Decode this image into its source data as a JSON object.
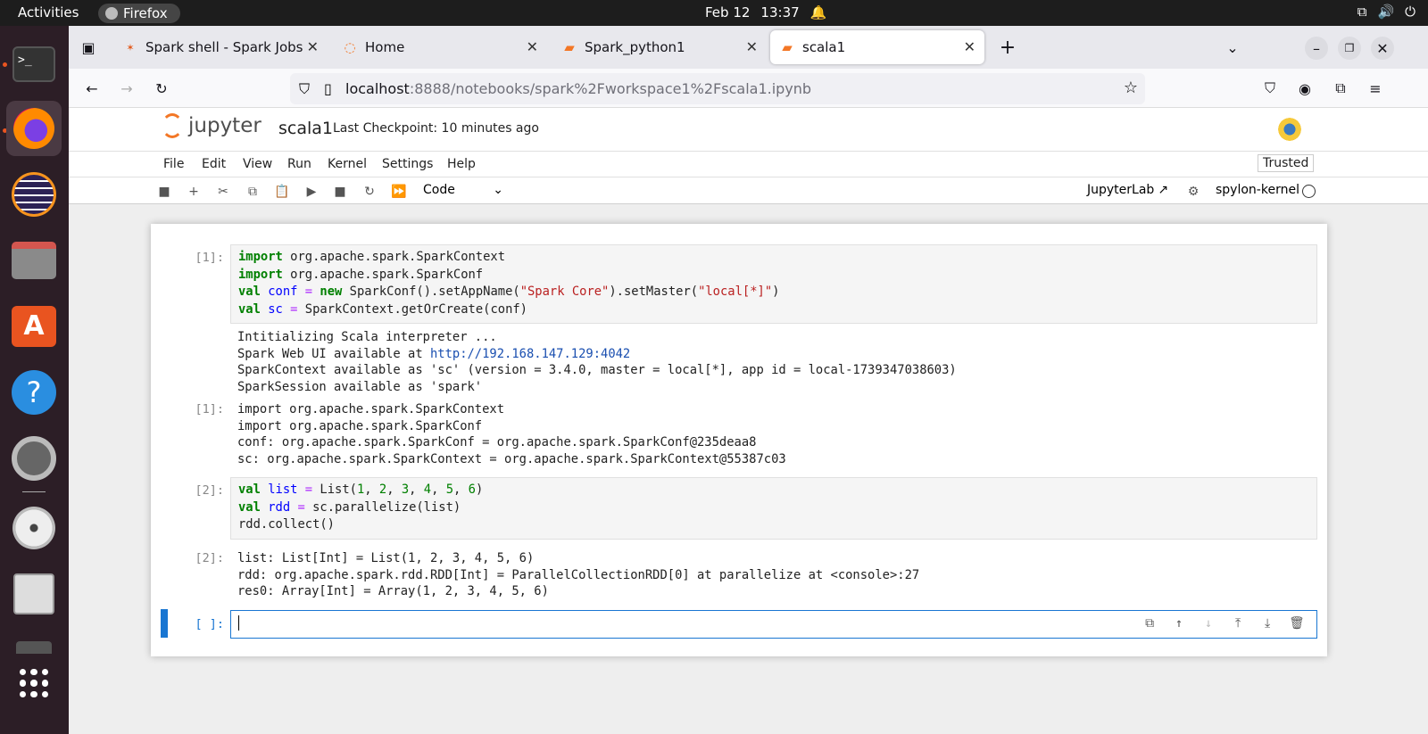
{
  "topbar": {
    "activities": "Activities",
    "app": "Firefox",
    "date": "Feb 12",
    "time": "13:37"
  },
  "tabs": [
    {
      "label": "Spark shell - Spark Jobs",
      "icon": "spark-icon"
    },
    {
      "label": "Home",
      "icon": "jupyter-icon"
    },
    {
      "label": "Spark_python1",
      "icon": "notebook-icon"
    },
    {
      "label": "scala1",
      "icon": "notebook-icon"
    }
  ],
  "url": {
    "host": "localhost",
    "path": ":8888/notebooks/spark%2Fworkspace1%2Fscala1.ipynb"
  },
  "jupyter": {
    "logo": "jupyter",
    "notebook": "scala1",
    "checkpoint": "Last Checkpoint: 10 minutes ago",
    "trusted": "Trusted"
  },
  "menu": [
    "File",
    "Edit",
    "View",
    "Run",
    "Kernel",
    "Settings",
    "Help"
  ],
  "toolbar": {
    "cell_type": "Code",
    "jupyterlab": "JupyterLab",
    "kernel": "spylon-kernel"
  },
  "cells": {
    "c1": {
      "prompt": "[1]:",
      "out_prompt": "[1]:",
      "src1_kw": "import",
      "src1_rest": " org.apache.spark.SparkContext",
      "src2_kw": "import",
      "src2_rest": " org.apache.spark.SparkConf",
      "src3_kw": "val",
      "src3_var": "conf",
      "src3_eq": "=",
      "src3_new": "new",
      "src3_a": " SparkConf().setAppName(",
      "src3_s1": "\"Spark Core\"",
      "src3_b": ").setMaster(",
      "src3_s2": "\"local[*]\"",
      "src3_c": ")",
      "src4_kw": "val",
      "src4_var": "sc",
      "src4_eq": "=",
      "src4_rest": " SparkContext.getOrCreate(conf)",
      "stream1": "Intitializing Scala interpreter ...",
      "stream2a": "Spark Web UI available at ",
      "stream2_link": "http://192.168.147.129:4042",
      "stream3": "SparkContext available as 'sc' (version = 3.4.0, master = local[*], app id = local-1739347038603)",
      "stream4": "SparkSession available as 'spark'",
      "out1": "import org.apache.spark.SparkContext",
      "out2": "import org.apache.spark.SparkConf",
      "out3": "conf: org.apache.spark.SparkConf = org.apache.spark.SparkConf@235deaa8",
      "out4": "sc: org.apache.spark.SparkContext = org.apache.spark.SparkContext@55387c03"
    },
    "c2": {
      "prompt": "[2]:",
      "out_prompt": "[2]:",
      "src1_kw": "val",
      "src1_var": "list",
      "src1_eq": "=",
      "src1_a": " List(",
      "nums": [
        "1",
        "2",
        "3",
        "4",
        "5",
        "6"
      ],
      "src1_c": ")",
      "src2_kw": "val",
      "src2_var": "rdd",
      "src2_eq": "=",
      "src2_rest": " sc.parallelize(list)",
      "src3": "rdd.collect()",
      "out1": "list: List[Int] = List(1, 2, 3, 4, 5, 6)",
      "out2": "rdd: org.apache.spark.rdd.RDD[Int] = ParallelCollectionRDD[0] at parallelize at <console>:27",
      "out3": "res0: Array[Int] = Array(1, 2, 3, 4, 5, 6)"
    },
    "c3": {
      "prompt": "[ ]:"
    }
  }
}
